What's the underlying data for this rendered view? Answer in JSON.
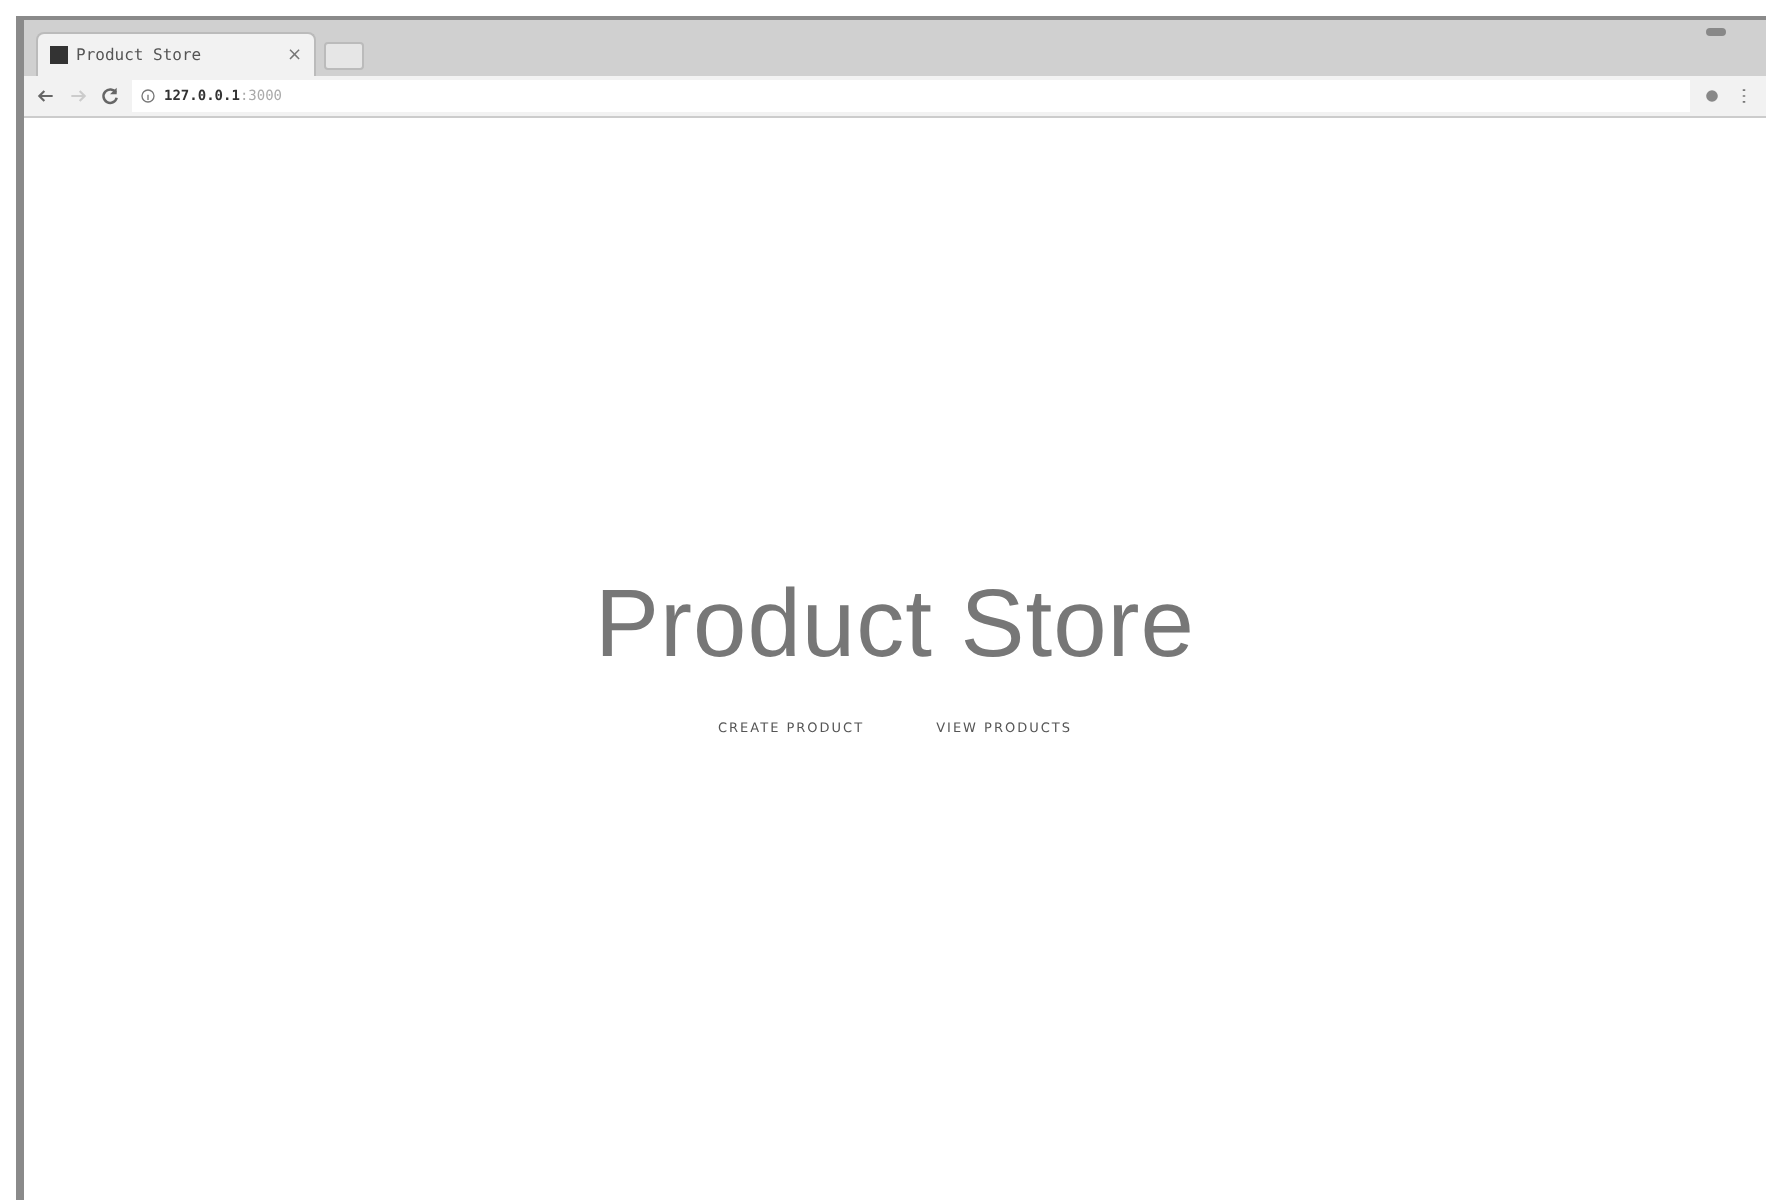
{
  "browser": {
    "tab": {
      "title": "Product Store",
      "close": "×"
    },
    "address": {
      "host": "127.0.0.1",
      "port": ":3000"
    }
  },
  "page": {
    "heading": "Product Store",
    "buttons": [
      "CREATE PRODUCT",
      "VIEW PRODUCTS"
    ]
  }
}
